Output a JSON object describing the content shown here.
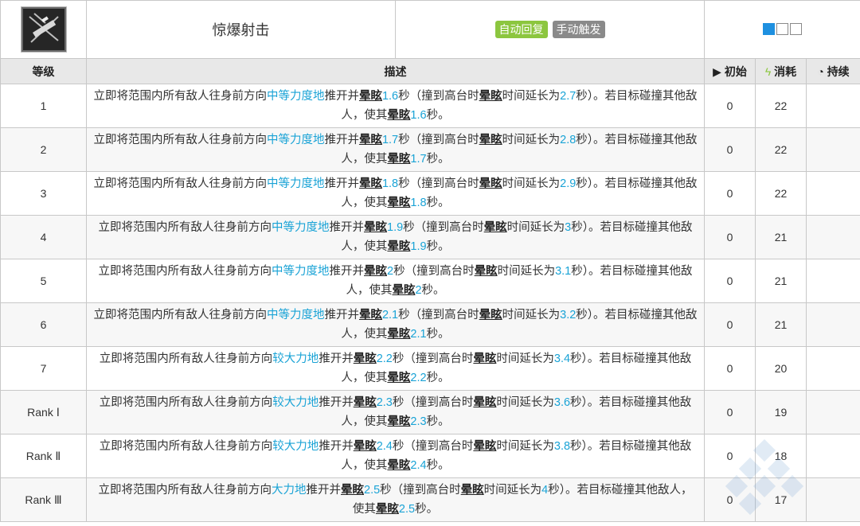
{
  "skill": {
    "icon": "explosion-shot-icon",
    "name": "惊爆射击",
    "tags": [
      "自动回复",
      "手动触发"
    ],
    "level_boxes": {
      "filled": 1,
      "total": 3
    }
  },
  "header": {
    "level": "等级",
    "description": "描述",
    "initial": "初始",
    "cost": "消耗",
    "duration": "持续"
  },
  "colors": {
    "accent": "#1aa3d6",
    "auto_tag": "#8cc63f",
    "manual_tag": "#8a8a8a",
    "box_filled": "#1e90e0"
  },
  "rows": [
    {
      "level": "1",
      "pre": "立即将范围内所有敌人往身前方向",
      "force": "中等力度地",
      "mid": "推开并",
      "stun1": "晕眩",
      "s1": "1.6",
      "a": "秒（撞到高台时",
      "stun2": "晕眩",
      "b": "时间延长为",
      "s2": "2.7",
      "c": "秒）。若目标碰撞其他敌人，使其",
      "stun3": "晕眩",
      "s3": "1.6",
      "d": "秒。",
      "initial": "0",
      "cost": "22",
      "duration": ""
    },
    {
      "level": "2",
      "pre": "立即将范围内所有敌人往身前方向",
      "force": "中等力度地",
      "mid": "推开并",
      "stun1": "晕眩",
      "s1": "1.7",
      "a": "秒（撞到高台时",
      "stun2": "晕眩",
      "b": "时间延长为",
      "s2": "2.8",
      "c": "秒）。若目标碰撞其他敌人，使其",
      "stun3": "晕眩",
      "s3": "1.7",
      "d": "秒。",
      "initial": "0",
      "cost": "22",
      "duration": ""
    },
    {
      "level": "3",
      "pre": "立即将范围内所有敌人往身前方向",
      "force": "中等力度地",
      "mid": "推开并",
      "stun1": "晕眩",
      "s1": "1.8",
      "a": "秒（撞到高台时",
      "stun2": "晕眩",
      "b": "时间延长为",
      "s2": "2.9",
      "c": "秒）。若目标碰撞其他敌人，使其",
      "stun3": "晕眩",
      "s3": "1.8",
      "d": "秒。",
      "initial": "0",
      "cost": "22",
      "duration": ""
    },
    {
      "level": "4",
      "pre": "立即将范围内所有敌人往身前方向",
      "force": "中等力度地",
      "mid": "推开并",
      "stun1": "晕眩",
      "s1": "1.9",
      "a": "秒（撞到高台时",
      "stun2": "晕眩",
      "b": "时间延长为",
      "s2": "3",
      "c": "秒）。若目标碰撞其他敌人，使其",
      "stun3": "晕眩",
      "s3": "1.9",
      "d": "秒。",
      "initial": "0",
      "cost": "21",
      "duration": ""
    },
    {
      "level": "5",
      "pre": "立即将范围内所有敌人往身前方向",
      "force": "中等力度地",
      "mid": "推开并",
      "stun1": "晕眩",
      "s1": "2",
      "a": "秒（撞到高台时",
      "stun2": "晕眩",
      "b": "时间延长为",
      "s2": "3.1",
      "c": "秒）。若目标碰撞其他敌人，使其",
      "stun3": "晕眩",
      "s3": "2",
      "d": "秒。",
      "initial": "0",
      "cost": "21",
      "duration": ""
    },
    {
      "level": "6",
      "pre": "立即将范围内所有敌人往身前方向",
      "force": "中等力度地",
      "mid": "推开并",
      "stun1": "晕眩",
      "s1": "2.1",
      "a": "秒（撞到高台时",
      "stun2": "晕眩",
      "b": "时间延长为",
      "s2": "3.2",
      "c": "秒）。若目标碰撞其他敌人，使其",
      "stun3": "晕眩",
      "s3": "2.1",
      "d": "秒。",
      "initial": "0",
      "cost": "21",
      "duration": ""
    },
    {
      "level": "7",
      "pre": "立即将范围内所有敌人往身前方向",
      "force": "较大力地",
      "mid": "推开并",
      "stun1": "晕眩",
      "s1": "2.2",
      "a": "秒（撞到高台时",
      "stun2": "晕眩",
      "b": "时间延长为",
      "s2": "3.4",
      "c": "秒）。若目标碰撞其他敌人，使其",
      "stun3": "晕眩",
      "s3": "2.2",
      "d": "秒。",
      "initial": "0",
      "cost": "20",
      "duration": ""
    },
    {
      "level": "Rank Ⅰ",
      "pre": "立即将范围内所有敌人往身前方向",
      "force": "较大力地",
      "mid": "推开并",
      "stun1": "晕眩",
      "s1": "2.3",
      "a": "秒（撞到高台时",
      "stun2": "晕眩",
      "b": "时间延长为",
      "s2": "3.6",
      "c": "秒）。若目标碰撞其他敌人，使其",
      "stun3": "晕眩",
      "s3": "2.3",
      "d": "秒。",
      "initial": "0",
      "cost": "19",
      "duration": ""
    },
    {
      "level": "Rank Ⅱ",
      "pre": "立即将范围内所有敌人往身前方向",
      "force": "较大力地",
      "mid": "推开并",
      "stun1": "晕眩",
      "s1": "2.4",
      "a": "秒（撞到高台时",
      "stun2": "晕眩",
      "b": "时间延长为",
      "s2": "3.8",
      "c": "秒）。若目标碰撞其他敌人，使其",
      "stun3": "晕眩",
      "s3": "2.4",
      "d": "秒。",
      "initial": "0",
      "cost": "18",
      "duration": ""
    },
    {
      "level": "Rank Ⅲ",
      "pre": "立即将范围内所有敌人往身前方向",
      "force": "大力地",
      "mid": "推开并",
      "stun1": "晕眩",
      "s1": "2.5",
      "a": "秒（撞到高台时",
      "stun2": "晕眩",
      "b": "时间延长为",
      "s2": "4",
      "c": "秒）。若目标碰撞其他敌人，使其",
      "stun3": "晕眩",
      "s3": "2.5",
      "d": "秒。",
      "initial": "0",
      "cost": "17",
      "duration": ""
    }
  ]
}
